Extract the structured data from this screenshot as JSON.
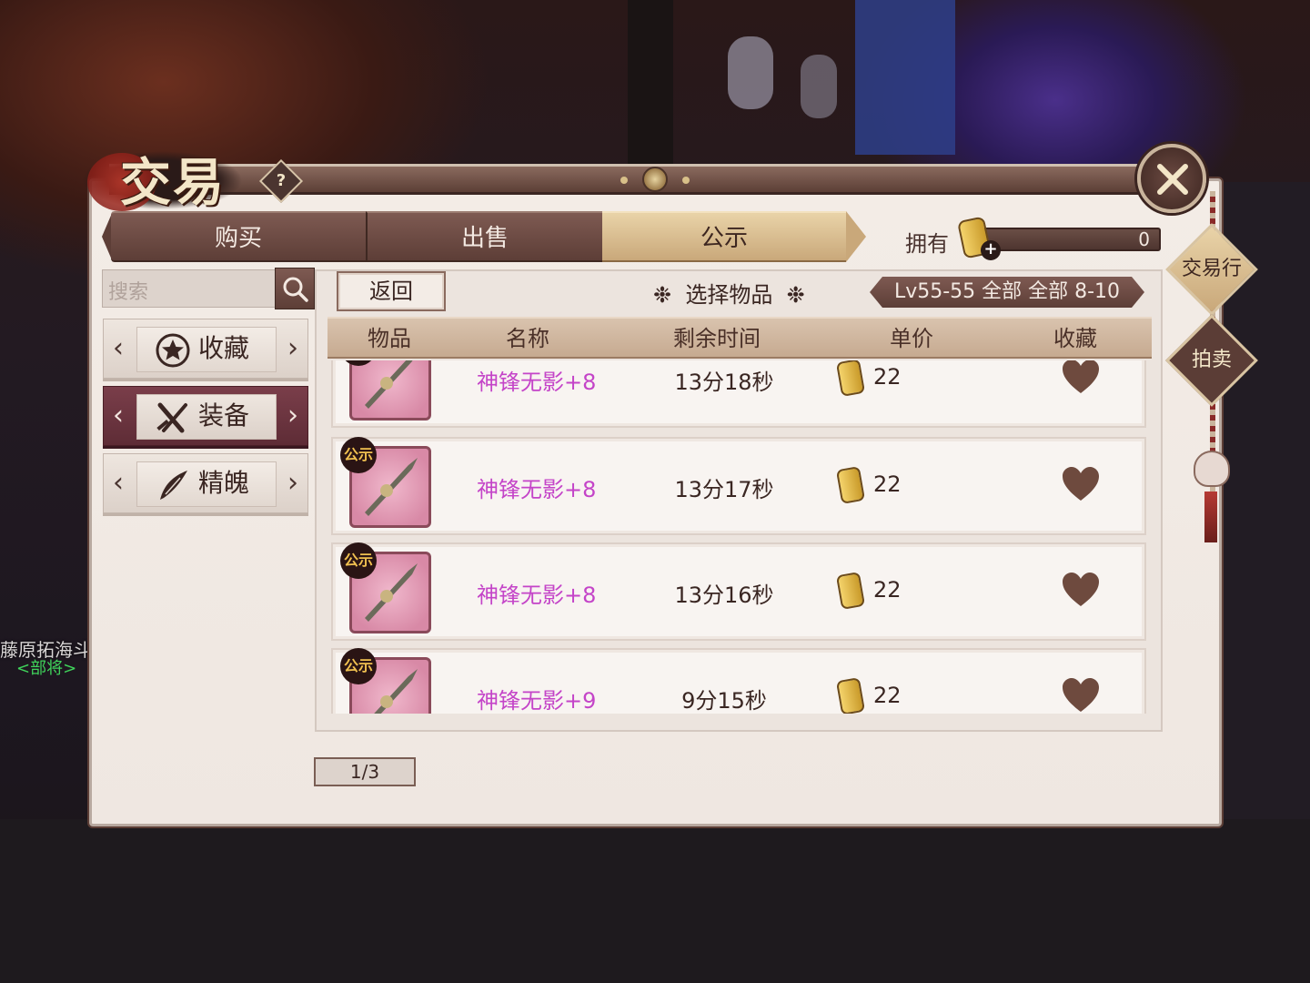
{
  "window": {
    "title": "交易",
    "help_label": "?"
  },
  "tabs": [
    {
      "label": "购买",
      "active": false
    },
    {
      "label": "出售",
      "active": false
    },
    {
      "label": "公示",
      "active": true
    }
  ],
  "currency": {
    "label": "拥有",
    "value": "0"
  },
  "side_buttons": {
    "trade_house": "交易行",
    "auction": "拍卖"
  },
  "search": {
    "placeholder": "搜索"
  },
  "categories": [
    {
      "label": "收藏",
      "icon": "star-icon",
      "active": false
    },
    {
      "label": "装备",
      "icon": "crossed-swords-icon",
      "active": true
    },
    {
      "label": "精魄",
      "icon": "feather-icon",
      "active": false
    }
  ],
  "list": {
    "back_label": "返回",
    "select_label": "选择物品",
    "filter_label": "Lv55-55 全部 全部 8-10",
    "columns": [
      "物品",
      "名称",
      "剩余时间",
      "单价",
      "收藏"
    ],
    "rows": [
      {
        "badge": "公示",
        "name": "神锋无影+8",
        "time": "13分18秒",
        "price": "22"
      },
      {
        "badge": "公示",
        "name": "神锋无影+8",
        "time": "13分17秒",
        "price": "22"
      },
      {
        "badge": "公示",
        "name": "神锋无影+8",
        "time": "13分16秒",
        "price": "22"
      },
      {
        "badge": "公示",
        "name": "神锋无影+9",
        "time": "9分15秒",
        "price": "22"
      }
    ]
  },
  "pagination": {
    "label": "1/3"
  },
  "background_npc": {
    "name": "藤原拓海斗",
    "title": "<部将>"
  },
  "colors": {
    "item_name": "#c444c8",
    "active_tab": "#c9a87a",
    "active_category": "#5e2c36"
  }
}
